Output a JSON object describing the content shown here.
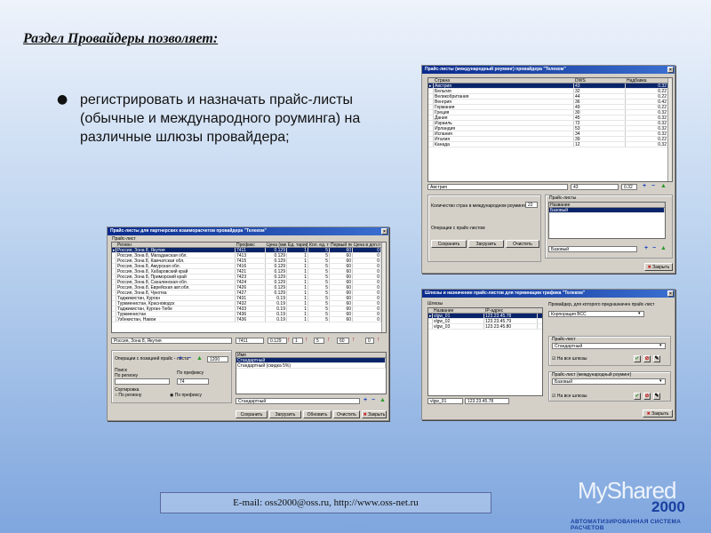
{
  "slide": {
    "title": "Раздел Провайдеры позволяет:",
    "bullet": "регистрировать и назначать прайс-листы (обычные и международного роуминга) на различные шлюзы провайдера;",
    "footer": "E-mail: oss2000@oss.ru,  http://www.oss-net.ru",
    "logo_text": "MyShared",
    "logo_number": "2000",
    "logo_subtitle": "АВТОМАТИЗИРОВАННАЯ СИСТЕМА РАСЧЕТОВ"
  },
  "win1": {
    "title": "Прайс-листы (международный роуминг) провайдера \"Телеком\"",
    "headers": [
      "Страна",
      "DWS",
      "Надбавка"
    ],
    "rows": [
      [
        "Австрия",
        "43",
        "0.32"
      ],
      [
        "Бельгия",
        "32",
        "0.22"
      ],
      [
        "Великобритания",
        "44",
        "0.22"
      ],
      [
        "Венгрия",
        "36",
        "0.42"
      ],
      [
        "Германия",
        "49",
        "0.22"
      ],
      [
        "Греция",
        "30",
        "0.32"
      ],
      [
        "Дания",
        "45",
        "0.32"
      ],
      [
        "Израиль",
        "72",
        "0.32"
      ],
      [
        "Ирландия",
        "53",
        "0.32"
      ],
      [
        "Испания",
        "34",
        "0.32"
      ],
      [
        "Италия",
        "39",
        "0.22"
      ],
      [
        "Канада",
        "12",
        "0.32"
      ]
    ],
    "edit_country": "Австрия",
    "edit_dws": "43",
    "edit_markup": "0.32",
    "count_label": "Количество стран в международном роуминге",
    "count_value": "22",
    "operations_label": "Операции с прайс-листом",
    "btn_save": "Сохранить",
    "btn_load": "Загрузить",
    "btn_clear": "Очистить",
    "pricelist_group": "Прайс-листы",
    "pricelist_header": "Название",
    "pricelist_selected": "Базовый",
    "pricelist_edit": "Базовый",
    "close": "Закрыть"
  },
  "win2": {
    "title": "Прайс-листы для партнерских взаиморасчетов провайдера \"Телеком\"",
    "subtitle": "Прайс-лист",
    "headers": [
      "Регион",
      "Префикс",
      "Цена (мин)",
      "Ед. тарифа",
      "Кол. ед. тарифа",
      "Первый период",
      "Цена в доп.период"
    ],
    "rows": [
      [
        "Россия, Зона 8, Якутия",
        "7411",
        "0.129",
        "1",
        "5",
        "60",
        "0"
      ],
      [
        "Россия, Зона 8, Магаданская обл.",
        "7413",
        "0.129",
        "1",
        "5",
        "60",
        "0"
      ],
      [
        "Россия, Зона 8, Камчатская обл.",
        "7415",
        "0.129",
        "1",
        "5",
        "60",
        "0"
      ],
      [
        "Россия, Зона 8, Амурская обл.",
        "7416",
        "0.129",
        "1",
        "5",
        "60",
        "0"
      ],
      [
        "Россия, Зона 8, Хабаровский край",
        "7421",
        "0.129",
        "1",
        "5",
        "60",
        "0"
      ],
      [
        "Россия, Зона 8, Приморский край",
        "7423",
        "0.129",
        "1",
        "5",
        "60",
        "0"
      ],
      [
        "Россия, Зона 8, Сахалинская обл.",
        "7424",
        "0.129",
        "1",
        "5",
        "60",
        "0"
      ],
      [
        "Россия, Зона 8, Еврейская авт.обл.",
        "7426",
        "0.129",
        "1",
        "5",
        "60",
        "0"
      ],
      [
        "Россия, Зона 8, Чукотка",
        "7427",
        "0.129",
        "1",
        "5",
        "60",
        "0"
      ],
      [
        "Таджикистан, Курган",
        "7431",
        "0.19",
        "1",
        "5",
        "60",
        "0"
      ],
      [
        "Туркменистан, Красноводск",
        "7432",
        "0.19",
        "1",
        "5",
        "60",
        "0"
      ],
      [
        "Таджикистан, Курган-Тюбе",
        "7433",
        "0.19",
        "1",
        "5",
        "60",
        "0"
      ],
      [
        "Туркменистан",
        "7436",
        "0.19",
        "1",
        "5",
        "60",
        "0"
      ],
      [
        "Узбекистан, Навои",
        "7436",
        "0.19",
        "1",
        "5",
        "60",
        "0"
      ]
    ],
    "edit_region": "Россия, Зона 8, Якутия",
    "edit_prefix": "7411",
    "edit_price": "0.129",
    "edit_unit": "1",
    "edit_count": "5",
    "edit_first": "60",
    "edit_extra": "0",
    "ops_label": "Операции с позицией прайс - листа",
    "ops_value": "1200",
    "search_label": "Поиск",
    "by_region": "По региону",
    "by_prefix": "По префиксу",
    "prefix_value": "74",
    "sort_label": "Сортировка",
    "sort_region": "По региону",
    "sort_prefix": "По префиксу",
    "list_header": "Имя",
    "list_items": [
      "Стандартный",
      "Стандартный (скидка 5%)"
    ],
    "list_edit": "Стандартный",
    "btn_save": "Сохранить",
    "btn_load": "Загрузить",
    "btn_update": "Обновить",
    "btn_clear": "Очистить",
    "btn_close": "Закрыть"
  },
  "win3": {
    "title": "Шлюзы и назначение прайс-листов для терминации трафика \"Телеком\"",
    "gateways_label": "Шлюзы",
    "headers": [
      "Название",
      "IP-адрес"
    ],
    "rows": [
      [
        "vlgw_01",
        "123.23.45.78"
      ],
      [
        "vlgw_02",
        "123.23.45.79"
      ],
      [
        "vlgw_03",
        "123.23.45.80"
      ]
    ],
    "edit_name": "vlgw_01",
    "edit_ip": "123.23.45.78",
    "provider_label": "Провайдер, для которого предназначен прайс-лист",
    "provider_value": "Корпорация ВСС",
    "pricelist_group": "Прайс-лист",
    "pricelist_value": "Стандартный",
    "roaming_group": "Прайс-лист (международный роуминг)",
    "roaming_value": "Базовый",
    "check_label": "На все шлюзы",
    "close": "Закрыть"
  }
}
